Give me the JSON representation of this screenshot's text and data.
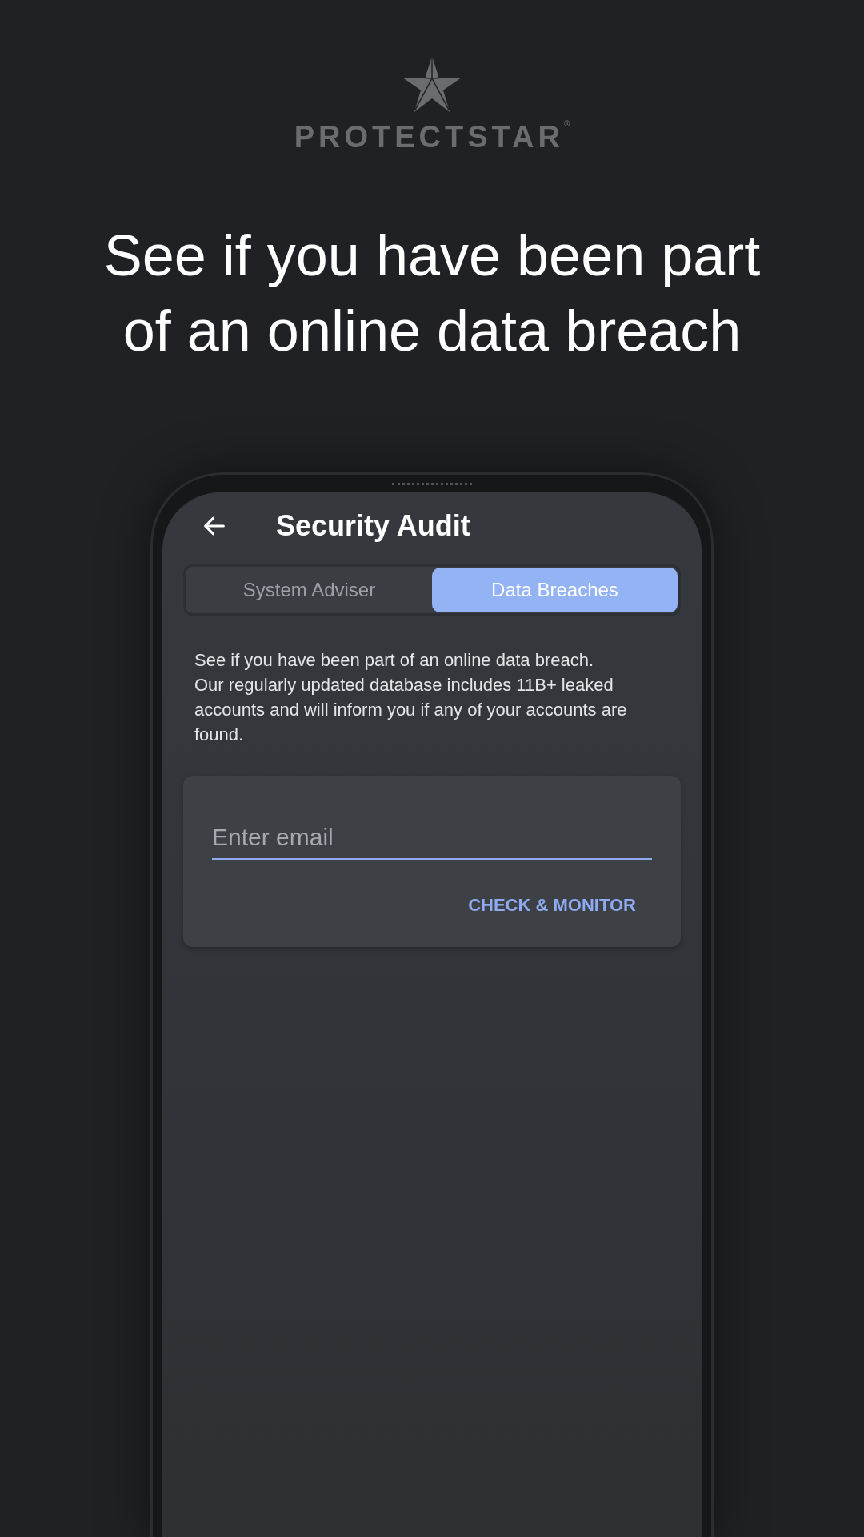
{
  "brand": {
    "name": "PROTECTSTAR",
    "mark": "®"
  },
  "headline": "See if you have been part of an online data breach",
  "app": {
    "title": "Security Audit",
    "tabs": [
      {
        "label": "System Adviser",
        "selected": false
      },
      {
        "label": "Data Breaches",
        "selected": true
      }
    ],
    "description": "See if you have been part of an online data breach.\nOur regularly updated database includes 11B+ leaked accounts and will inform you if any of your accounts are found.",
    "email_field": {
      "placeholder": "Enter email"
    },
    "button": "CHECK & MONITOR"
  }
}
